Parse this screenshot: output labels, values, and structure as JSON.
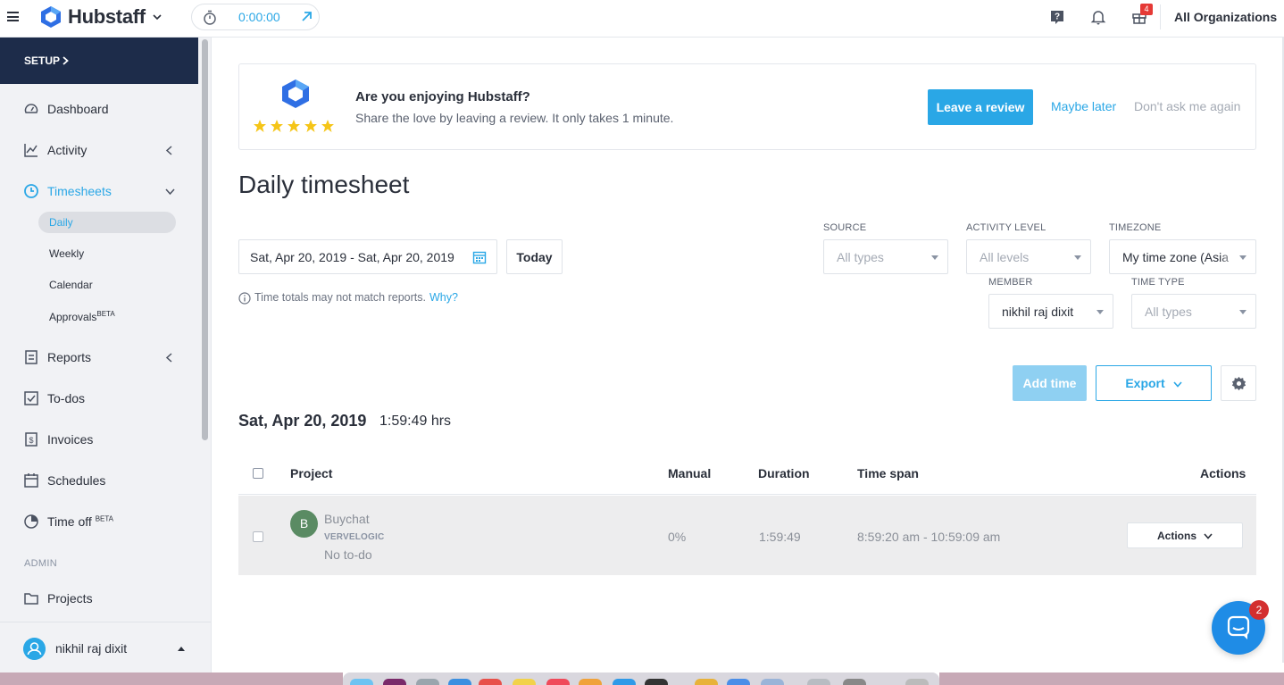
{
  "topbar": {
    "brand": "Hubstaff",
    "timer": "0:00:00",
    "notification_count": "4",
    "org": "All Organizations"
  },
  "sidebar": {
    "setup": "SETUP",
    "items": [
      {
        "label": "Dashboard"
      },
      {
        "label": "Activity"
      },
      {
        "label": "Timesheets"
      },
      {
        "label": "Reports"
      },
      {
        "label": "To-dos"
      },
      {
        "label": "Invoices"
      },
      {
        "label": "Schedules"
      },
      {
        "label": "Time off",
        "sup": "BETA"
      },
      {
        "label": "Projects"
      }
    ],
    "sub_items": [
      {
        "label": "Daily"
      },
      {
        "label": "Weekly"
      },
      {
        "label": "Calendar"
      },
      {
        "label": "Approvals",
        "sup": "BETA"
      }
    ],
    "admin_label": "ADMIN",
    "user": "nikhil raj dixit"
  },
  "review": {
    "title": "Are you enjoying Hubstaff?",
    "subtitle": "Share the love by leaving a review. It only takes 1 minute.",
    "leave_review": "Leave a review",
    "maybe_later": "Maybe later",
    "dont_ask": "Don't ask me again",
    "stars": 5
  },
  "page": {
    "title": "Daily timesheet",
    "date_range": "Sat, Apr 20, 2019 - Sat, Apr 20, 2019",
    "today": "Today",
    "note": "Time totals may not match reports.",
    "note_link": "Why?"
  },
  "filters": {
    "source": {
      "label": "SOURCE",
      "value": "All types"
    },
    "activity": {
      "label": "ACTIVITY LEVEL",
      "value": "All levels"
    },
    "timezone": {
      "label": "TIMEZONE",
      "value": "My time zone (Asia"
    },
    "member": {
      "label": "MEMBER",
      "value": "nikhil raj dixit"
    },
    "time_type": {
      "label": "TIME TYPE",
      "value": "All types"
    }
  },
  "toolbar": {
    "add_time": "Add time",
    "export": "Export"
  },
  "day": {
    "date": "Sat, Apr 20, 2019",
    "total": "1:59:49 hrs"
  },
  "table": {
    "headers": {
      "project": "Project",
      "manual": "Manual",
      "duration": "Duration",
      "time_span": "Time span",
      "actions": "Actions"
    },
    "rows": [
      {
        "avatar": "B",
        "project": "Buychat",
        "org": "VERVELOGIC",
        "todo": "No to-do",
        "manual": "0%",
        "duration": "1:59:49",
        "time_span": "8:59:20 am - 10:59:09 am",
        "actions": "Actions"
      }
    ]
  },
  "chat": {
    "badge": "2"
  },
  "colors": {
    "accent": "#2aa7e6",
    "sidebar_header": "#1d2c4a",
    "avatar_green": "#5a8b63",
    "star": "#f5c518",
    "badge_red": "#e53935"
  }
}
